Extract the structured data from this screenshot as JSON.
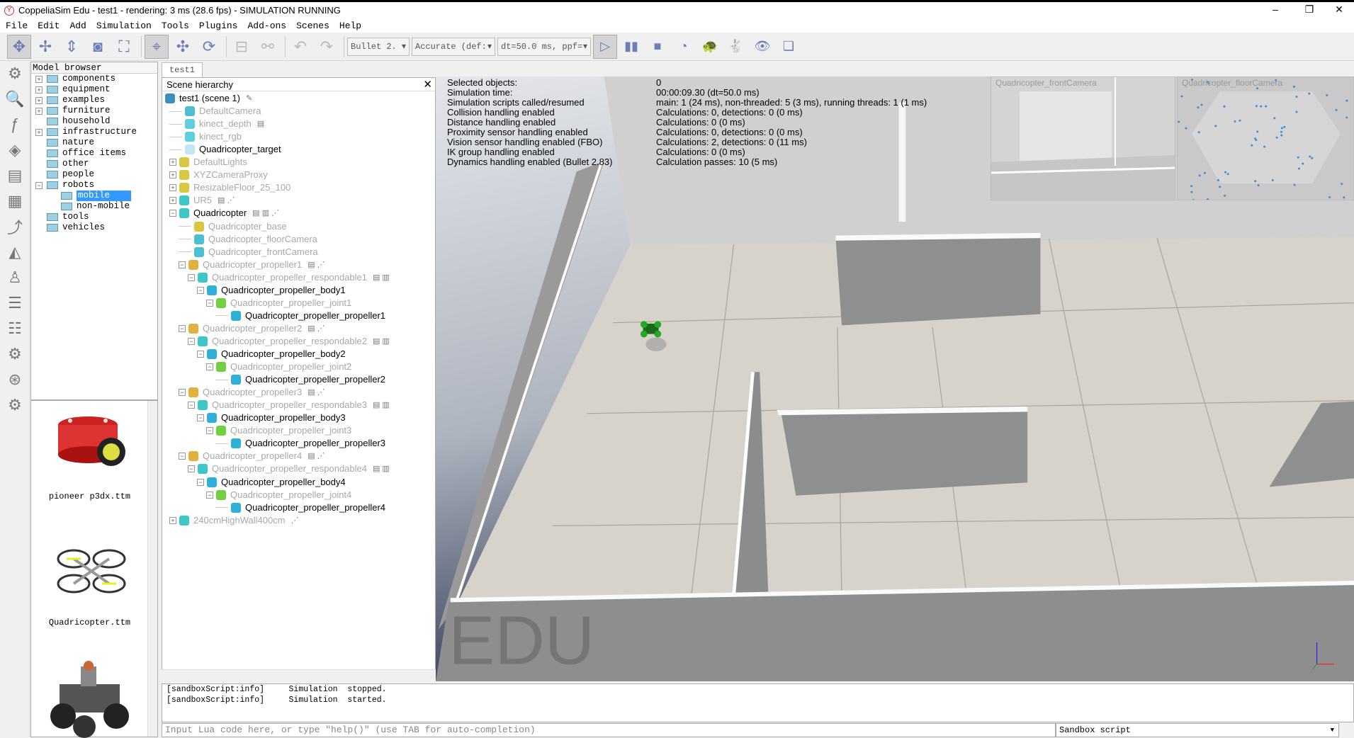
{
  "window": {
    "title": "CoppeliaSim Edu - test1 - rendering: 3 ms (28.6 fps) - SIMULATION RUNNING",
    "minimize": "–",
    "restore": "❐",
    "close": "✕"
  },
  "menu": [
    "File",
    "Edit",
    "Add",
    "Simulation",
    "Tools",
    "Plugins",
    "Add-ons",
    "Scenes",
    "Help"
  ],
  "toolbar": {
    "buttons": [
      {
        "name": "camera-pan-icon",
        "glyph": "✥",
        "state": "active"
      },
      {
        "name": "camera-rotate-icon",
        "glyph": "✢"
      },
      {
        "name": "camera-shift-icon",
        "glyph": "⇕"
      },
      {
        "name": "camera-angle-icon",
        "glyph": "◙"
      },
      {
        "name": "fit-to-view-icon",
        "glyph": "⛶"
      },
      {
        "name": "click-selection-icon",
        "glyph": "⌖",
        "state": "active"
      },
      {
        "name": "object-shift-icon",
        "glyph": "✣"
      },
      {
        "name": "object-rotate-icon",
        "glyph": "⟳"
      },
      {
        "name": "assemble-icon",
        "glyph": "⊟",
        "state": "disabled"
      },
      {
        "name": "transfer-dna-icon",
        "glyph": "⚯",
        "state": "disabled"
      },
      {
        "name": "undo-icon",
        "glyph": "↶",
        "state": "disabled"
      },
      {
        "name": "redo-icon",
        "glyph": "↷",
        "state": "disabled"
      }
    ],
    "engine": "Bullet 2.",
    "accuracy": "Accurate (def:",
    "timestep": "dt=50.0 ms, ppf=",
    "sim_buttons": [
      {
        "name": "start-simulation-icon",
        "glyph": "▷",
        "state": "active"
      },
      {
        "name": "pause-simulation-icon",
        "glyph": "▮▮"
      },
      {
        "name": "stop-simulation-icon",
        "glyph": "■"
      },
      {
        "name": "realtime-icon",
        "glyph": "◔"
      },
      {
        "name": "slow-down-icon",
        "glyph": "🐢"
      },
      {
        "name": "speed-up-icon",
        "glyph": "🐇"
      },
      {
        "name": "visualization-toggle-icon",
        "glyph": "👁"
      },
      {
        "name": "page-selector-icon",
        "glyph": "❏"
      }
    ]
  },
  "left_tools": [
    "simulation-settings-icon",
    "selection-icon",
    "calculation-modules-icon",
    "collections-icon",
    "scripts-icon",
    "shape-edit-icon",
    "path-edit-icon",
    "layers-icon",
    "ik-icon",
    "user-settings-icon",
    "model-browser-toggle-icon",
    "scene-hierarchy-toggle-icon",
    "video-recorder-icon",
    "settings-icon"
  ],
  "model_browser": {
    "title": "Model browser",
    "items": [
      {
        "label": "components",
        "level": 0,
        "expander": "+"
      },
      {
        "label": "equipment",
        "level": 0,
        "expander": "+"
      },
      {
        "label": "examples",
        "level": 0,
        "expander": "+"
      },
      {
        "label": "furniture",
        "level": 0,
        "expander": "+"
      },
      {
        "label": "household",
        "level": 0
      },
      {
        "label": "infrastructure",
        "level": 0,
        "expander": "+"
      },
      {
        "label": "nature",
        "level": 0
      },
      {
        "label": "office items",
        "level": 0
      },
      {
        "label": "other",
        "level": 0
      },
      {
        "label": "people",
        "level": 0
      },
      {
        "label": "robots",
        "level": 0,
        "expander": "−"
      },
      {
        "label": "mobile",
        "level": 1,
        "selected": true
      },
      {
        "label": "non-mobile",
        "level": 1
      },
      {
        "label": "tools",
        "level": 0
      },
      {
        "label": "vehicles",
        "level": 0
      }
    ],
    "thumbnails": [
      "pioneer p3dx.ttm",
      "Quadricopter.ttm"
    ]
  },
  "scene_tab": "test1",
  "hierarchy": {
    "title": "Scene hierarchy",
    "close": "✕",
    "rows": [
      {
        "name": "test1 (scene 1)",
        "level": 0,
        "icon": "#3a8fc0",
        "extra": "✎"
      },
      {
        "name": "DefaultCamera",
        "level": 1,
        "grey": true,
        "icon": "#4cc0d0"
      },
      {
        "name": "kinect_depth",
        "level": 1,
        "grey": true,
        "icon": "#5ccfe0",
        "extra": "▤"
      },
      {
        "name": "kinect_rgb",
        "level": 1,
        "grey": true,
        "icon": "#5ccfe0"
      },
      {
        "name": "Quadricopter_target",
        "level": 1,
        "icon": "#bfe8f4"
      },
      {
        "name": "DefaultLights",
        "level": 1,
        "grey": true,
        "icon": "#d8c840",
        "expander": "+"
      },
      {
        "name": "XYZCameraProxy",
        "level": 1,
        "grey": true,
        "icon": "#d8c840",
        "expander": "+"
      },
      {
        "name": "ResizableFloor_25_100",
        "level": 1,
        "grey": true,
        "icon": "#d8c840",
        "expander": "+"
      },
      {
        "name": "UR5",
        "level": 1,
        "grey": true,
        "icon": "#3cc8c8",
        "expander": "+",
        "extra": "▤   ⋰"
      },
      {
        "name": "Quadricopter",
        "level": 1,
        "icon": "#3cc8c8",
        "expander": "−",
        "extra": "▤ ▥     ⋰"
      },
      {
        "name": "Quadricopter_base",
        "level": 2,
        "grey": true,
        "icon": "#d8c840"
      },
      {
        "name": "Quadricopter_floorCamera",
        "level": 2,
        "grey": true,
        "icon": "#4cc0d0"
      },
      {
        "name": "Quadricopter_frontCamera",
        "level": 2,
        "grey": true,
        "icon": "#4cc0d0"
      },
      {
        "name": "Quadricopter_propeller1",
        "level": 2,
        "grey": true,
        "icon": "#e0b040",
        "expander": "−",
        "extra": "▤     ⋰"
      },
      {
        "name": "Quadricopter_propeller_respondable1",
        "level": 3,
        "grey": true,
        "icon": "#3cc8c8",
        "expander": "−",
        "extra": "▤ ▥"
      },
      {
        "name": "Quadricopter_propeller_body1",
        "level": 4,
        "icon": "#30b0d8",
        "expander": "−"
      },
      {
        "name": "Quadricopter_propeller_joint1",
        "level": 5,
        "grey": true,
        "icon": "#70d040",
        "expander": "−"
      },
      {
        "name": "Quadricopter_propeller_propeller1",
        "level": 6,
        "icon": "#30b0d8"
      },
      {
        "name": "Quadricopter_propeller2",
        "level": 2,
        "grey": true,
        "icon": "#e0b040",
        "expander": "−",
        "extra": "▤     ⋰"
      },
      {
        "name": "Quadricopter_propeller_respondable2",
        "level": 3,
        "grey": true,
        "icon": "#3cc8c8",
        "expander": "−",
        "extra": "▤ ▥"
      },
      {
        "name": "Quadricopter_propeller_body2",
        "level": 4,
        "icon": "#30b0d8",
        "expander": "−"
      },
      {
        "name": "Quadricopter_propeller_joint2",
        "level": 5,
        "grey": true,
        "icon": "#70d040",
        "expander": "−"
      },
      {
        "name": "Quadricopter_propeller_propeller2",
        "level": 6,
        "icon": "#30b0d8"
      },
      {
        "name": "Quadricopter_propeller3",
        "level": 2,
        "grey": true,
        "icon": "#e0b040",
        "expander": "−",
        "extra": "▤     ⋰"
      },
      {
        "name": "Quadricopter_propeller_respondable3",
        "level": 3,
        "grey": true,
        "icon": "#3cc8c8",
        "expander": "−",
        "extra": "▤ ▥"
      },
      {
        "name": "Quadricopter_propeller_body3",
        "level": 4,
        "icon": "#30b0d8",
        "expander": "−"
      },
      {
        "name": "Quadricopter_propeller_joint3",
        "level": 5,
        "grey": true,
        "icon": "#70d040",
        "expander": "−"
      },
      {
        "name": "Quadricopter_propeller_propeller3",
        "level": 6,
        "icon": "#30b0d8"
      },
      {
        "name": "Quadricopter_propeller4",
        "level": 2,
        "grey": true,
        "icon": "#e0b040",
        "expander": "−",
        "extra": "▤     ⋰"
      },
      {
        "name": "Quadricopter_propeller_respondable4",
        "level": 3,
        "grey": true,
        "icon": "#3cc8c8",
        "expander": "−",
        "extra": "▤ ▥"
      },
      {
        "name": "Quadricopter_propeller_body4",
        "level": 4,
        "icon": "#30b0d8",
        "expander": "−"
      },
      {
        "name": "Quadricopter_propeller_joint4",
        "level": 5,
        "grey": true,
        "icon": "#70d040",
        "expander": "−"
      },
      {
        "name": "Quadricopter_propeller_propeller4",
        "level": 6,
        "icon": "#30b0d8"
      },
      {
        "name": "240cmHighWall400cm",
        "level": 1,
        "grey": true,
        "icon": "#3cc8c8",
        "expander": "+",
        "extra": "      ⋰"
      }
    ]
  },
  "sim_info": [
    {
      "label": "Selected objects:",
      "value": "0"
    },
    {
      "label": "Simulation time:",
      "value": "00:00:09.30 (dt=50.0 ms)"
    },
    {
      "label": "Simulation scripts called/resumed",
      "value": "main: 1 (24 ms), non-threaded: 5 (3 ms), running threads: 1 (1 ms)"
    },
    {
      "label": "Collision handling enabled",
      "value": "Calculations: 0, detections: 0 (0 ms)"
    },
    {
      "label": "Distance handling enabled",
      "value": "Calculations: 0 (0 ms)"
    },
    {
      "label": "Proximity sensor handling enabled",
      "value": "Calculations: 0, detections: 0 (0 ms)"
    },
    {
      "label": "Vision sensor handling enabled (FBO)",
      "value": "Calculations: 2, detections: 0 (11 ms)"
    },
    {
      "label": "IK group handling enabled",
      "value": "Calculations: 0 (0 ms)"
    },
    {
      "label": "Dynamics handling enabled (Bullet 2.83)",
      "value": "Calculation passes: 10 (5 ms)"
    }
  ],
  "cameras": [
    {
      "label": "Quadricopter_frontCamera"
    },
    {
      "label": "Quadricopter_floorCamera"
    }
  ],
  "watermark": "EDU",
  "console": {
    "lines": [
      "[sandboxScript:info]     Simulation  stopped.",
      "[sandboxScript:info]     Simulation  started."
    ],
    "input_placeholder": "Input Lua code here, or type \"help()\" (use TAB for auto-completion)",
    "script_selector": "Sandbox script"
  },
  "colors": {
    "selection": "#3399ff",
    "viewport_bg_bottom": "#2a3450",
    "wall": "#8e8e8e",
    "floor": "#d8d3ca"
  }
}
